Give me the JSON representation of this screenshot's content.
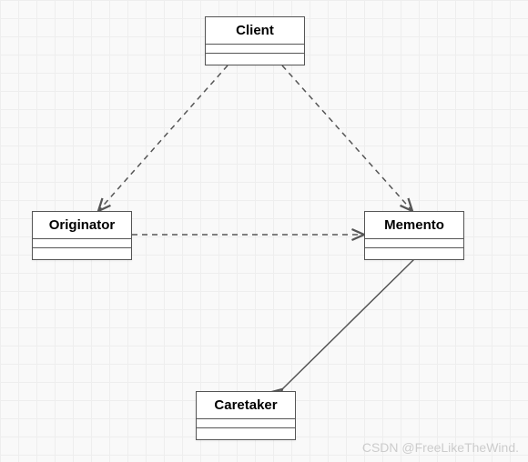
{
  "diagram": {
    "classes": {
      "client": {
        "name": "Client"
      },
      "originator": {
        "name": "Originator"
      },
      "memento": {
        "name": "Memento"
      },
      "caretaker": {
        "name": "Caretaker"
      }
    },
    "relations": [
      {
        "from": "Client",
        "to": "Originator",
        "type": "dependency",
        "style": "dashed-arrow"
      },
      {
        "from": "Client",
        "to": "Memento",
        "type": "dependency",
        "style": "dashed-arrow"
      },
      {
        "from": "Originator",
        "to": "Memento",
        "type": "dependency",
        "style": "dashed-arrow"
      },
      {
        "from": "Caretaker",
        "to": "Memento",
        "type": "aggregation",
        "style": "solid-diamond"
      }
    ]
  },
  "watermark": "CSDN @FreeLikeTheWind."
}
